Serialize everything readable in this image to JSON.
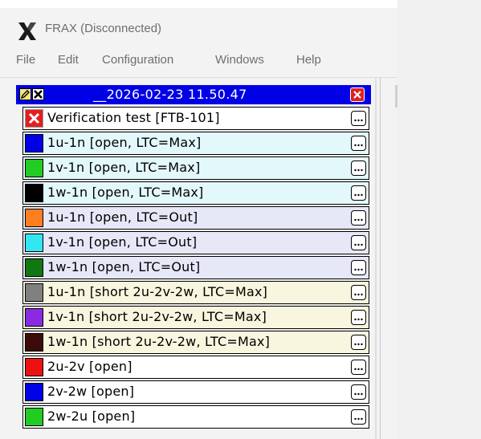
{
  "window": {
    "title": "FRAX (Disconnected)",
    "logo_icon": "frax-x-logo"
  },
  "menu": {
    "items": [
      "File",
      "Edit",
      "Configuration",
      "Windows",
      "Help"
    ]
  },
  "panel": {
    "title": "__2026-02-23 11.50.47",
    "header_color": "#0000e6",
    "rows": [
      {
        "label": "Verification test [FTB-101]",
        "color": "#ffffff",
        "icon": "red-x-icon",
        "bg": "#ffffff"
      },
      {
        "label": "1u-1n [open, LTC=Max]",
        "color": "#0000e6",
        "bg": "#e3f8fb"
      },
      {
        "label": "1v-1n [open, LTC=Max]",
        "color": "#22cc22",
        "bg": "#e3f8fb"
      },
      {
        "label": "1w-1n [open, LTC=Max]",
        "color": "#000000",
        "bg": "#e3f8fb"
      },
      {
        "label": "1u-1n [open, LTC=Out]",
        "color": "#ff7f1e",
        "bg": "#e6e8f8"
      },
      {
        "label": "1v-1n [open, LTC=Out]",
        "color": "#33e6f0",
        "bg": "#e6e8f8"
      },
      {
        "label": "1w-1n [open, LTC=Out]",
        "color": "#117711",
        "bg": "#e6e8f8"
      },
      {
        "label": "1u-1n [short 2u-2v-2w, LTC=Max]",
        "color": "#808080",
        "bg": "#f8f6de"
      },
      {
        "label": "1v-1n [short 2u-2v-2w, LTC=Max]",
        "color": "#8a2be2",
        "bg": "#f8f6de"
      },
      {
        "label": "1w-1n [short 2u-2v-2w, LTC=Max]",
        "color": "#3d0a0a",
        "bg": "#f8f6de"
      },
      {
        "label": "2u-2v [open]",
        "color": "#ee1111",
        "bg": "#ffffff"
      },
      {
        "label": "2v-2w [open]",
        "color": "#0000e6",
        "bg": "#ffffff"
      },
      {
        "label": "2w-2u [open]",
        "color": "#22cc22",
        "bg": "#ffffff"
      }
    ]
  }
}
